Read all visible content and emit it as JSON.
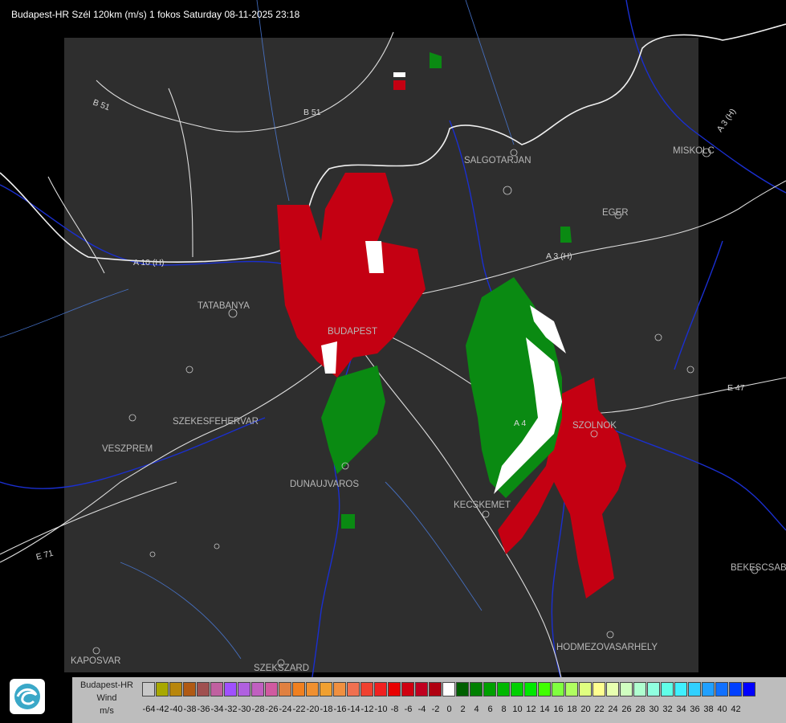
{
  "header": "Budapest-HR Szél 120km (m/s) 1 fokos Saturday 08-11-2025 23:18",
  "cities": [
    {
      "name": "SALGOTARJAN"
    },
    {
      "name": "MISKOLC"
    },
    {
      "name": "EGER"
    },
    {
      "name": "TATABANYA"
    },
    {
      "name": "BUDAPEST"
    },
    {
      "name": "SZEKESFEHERVAR"
    },
    {
      "name": "VESZPREM"
    },
    {
      "name": "DUNAUJVAROS"
    },
    {
      "name": "KECSKEMET"
    },
    {
      "name": "SZOLNOK"
    },
    {
      "name": "BEKESCSABA"
    },
    {
      "name": "HODMEZOVASARHELY"
    },
    {
      "name": "KAPOSVAR"
    },
    {
      "name": "SZEKSZARD"
    }
  ],
  "roads": [
    "B 51",
    "B 51",
    "A 3 (H)",
    "A 3 (H)",
    "A 10 (H)",
    "A 4",
    "E 47",
    "E 71"
  ],
  "legend": {
    "title_lines": [
      "Budapest-HR",
      "Wind",
      "m/s"
    ],
    "colors": [
      "#c8c8c8",
      "#a8a800",
      "#b8860b",
      "#b05a14",
      "#a05050",
      "#c060a0",
      "#a050ff",
      "#b060e0",
      "#c060c0",
      "#d05aa0",
      "#e08040",
      "#f08020",
      "#f09030",
      "#f0a030",
      "#f09040",
      "#f07050",
      "#f04030",
      "#f02020",
      "#e80000",
      "#d00010",
      "#c00020",
      "#b00010",
      "#ffffff",
      "#006000",
      "#008000",
      "#00a000",
      "#00b800",
      "#00d000",
      "#00e800",
      "#40ff00",
      "#80ff40",
      "#b0ff60",
      "#e0ff80",
      "#ffff90",
      "#e8ffb0",
      "#d0ffc0",
      "#b0ffd0",
      "#90ffe0",
      "#60ffe8",
      "#40f0ff",
      "#30d0ff",
      "#20a0ff",
      "#1070ff",
      "#0040ff",
      "#0000ff"
    ],
    "ticks": [
      "-64",
      "-42",
      "-40",
      "-38",
      "-36",
      "-34",
      "-32",
      "-30",
      "-28",
      "-26",
      "-24",
      "-22",
      "-20",
      "-18",
      "-16",
      "-14",
      "-12",
      "-10",
      "-8",
      "-6",
      "-4",
      "-2",
      "0",
      "2",
      "4",
      "6",
      "8",
      "10",
      "12",
      "14",
      "16",
      "18",
      "20",
      "22",
      "24",
      "26",
      "28",
      "30",
      "32",
      "34",
      "36",
      "38",
      "40",
      "42"
    ]
  }
}
